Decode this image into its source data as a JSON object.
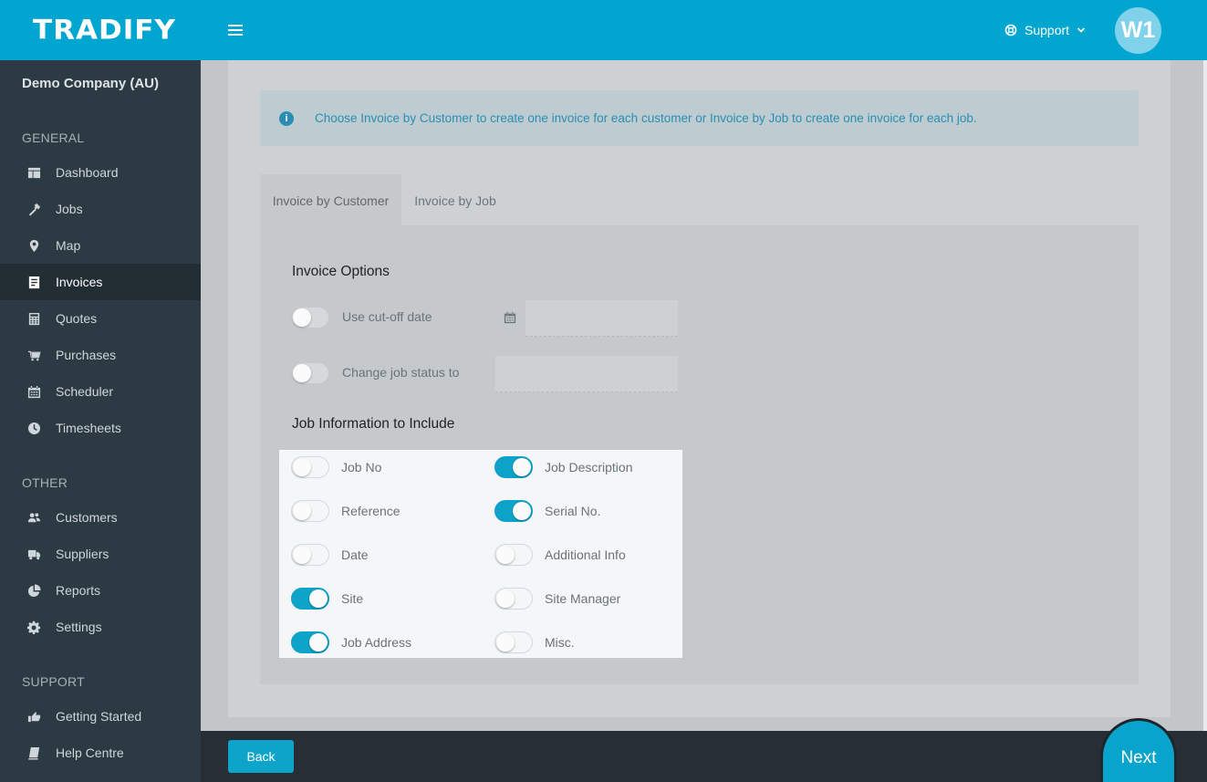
{
  "app": {
    "logo": "TRADIFY"
  },
  "header": {
    "support_label": "Support",
    "avatar_initials": "W1"
  },
  "sidebar": {
    "company": "Demo Company (AU)",
    "sections": {
      "general": "GENERAL",
      "other": "OTHER",
      "support": "SUPPORT"
    },
    "general_items": [
      {
        "label": "Dashboard",
        "icon": "dashboard-icon"
      },
      {
        "label": "Jobs",
        "icon": "hammer-icon"
      },
      {
        "label": "Map",
        "icon": "map-pin-icon"
      },
      {
        "label": "Invoices",
        "icon": "invoice-icon",
        "active": true
      },
      {
        "label": "Quotes",
        "icon": "calculator-icon"
      },
      {
        "label": "Purchases",
        "icon": "cart-icon"
      },
      {
        "label": "Scheduler",
        "icon": "calendar-icon"
      },
      {
        "label": "Timesheets",
        "icon": "clock-icon"
      }
    ],
    "other_items": [
      {
        "label": "Customers",
        "icon": "users-icon"
      },
      {
        "label": "Suppliers",
        "icon": "truck-icon"
      },
      {
        "label": "Reports",
        "icon": "pie-chart-icon"
      },
      {
        "label": "Settings",
        "icon": "gear-icon"
      }
    ],
    "support_items": [
      {
        "label": "Getting Started",
        "icon": "hand-point-icon"
      },
      {
        "label": "Help Centre",
        "icon": "book-icon"
      }
    ]
  },
  "info": {
    "text": "Choose Invoice by Customer to create one invoice for each customer or Invoice by Job to create one invoice for each job."
  },
  "tabs": [
    {
      "label": "Invoice by Customer",
      "active": true
    },
    {
      "label": "Invoice by Job",
      "active": false
    }
  ],
  "invoice_options": {
    "title": "Invoice Options",
    "use_cutoff_label": "Use cut-off date",
    "use_cutoff_on": false,
    "cutoff_date_value": "",
    "change_status_label": "Change job status to",
    "change_status_on": false,
    "status_value": ""
  },
  "job_info": {
    "title": "Job Information to Include",
    "left": [
      {
        "label": "Job No",
        "on": false
      },
      {
        "label": "Reference",
        "on": false
      },
      {
        "label": "Date",
        "on": false
      },
      {
        "label": "Site",
        "on": true
      },
      {
        "label": "Job Address",
        "on": true
      }
    ],
    "right": [
      {
        "label": "Job Description",
        "on": true
      },
      {
        "label": "Serial No.",
        "on": true
      },
      {
        "label": "Additional Info",
        "on": false
      },
      {
        "label": "Site Manager",
        "on": false
      },
      {
        "label": "Misc.",
        "on": false
      }
    ]
  },
  "footer": {
    "back_label": "Back",
    "next_label": "Next"
  },
  "colors": {
    "brand": "#00a6cf",
    "sidebar": "#2c3a43",
    "toggle_on": "#0ea3c9"
  }
}
